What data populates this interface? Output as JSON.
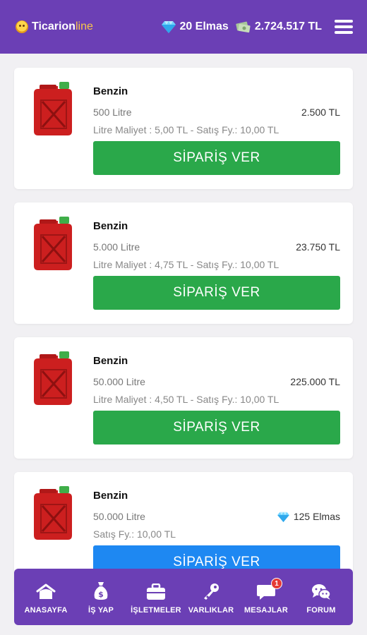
{
  "header": {
    "brand_main": "Ticarion",
    "brand_accent": "line",
    "diamonds": "20 Elmas",
    "balance": "2.724.517 TL",
    "icons": [
      "brand-logo-icon",
      "gem-icon",
      "money-icon",
      "menu-icon"
    ]
  },
  "products": [
    {
      "title": "Benzin",
      "quantity": "500 Litre",
      "price": "2.500 TL",
      "info": "Litre Maliyet : 5,00 TL - Satış Fy.: 10,00 TL",
      "button": "SİPARİŞ VER",
      "button_color": "#2aa84a"
    },
    {
      "title": "Benzin",
      "quantity": "5.000 Litre",
      "price": "23.750 TL",
      "info": "Litre Maliyet : 4,75 TL - Satış Fy.: 10,00 TL",
      "button": "SİPARİŞ VER",
      "button_color": "#2aa84a"
    },
    {
      "title": "Benzin",
      "quantity": "50.000 Litre",
      "price": "225.000 TL",
      "info": "Litre Maliyet : 4,50 TL - Satış Fy.: 10,00 TL",
      "button": "SİPARİŞ VER",
      "button_color": "#2aa84a"
    },
    {
      "title": "Benzin",
      "quantity": "50.000 Litre",
      "price": "125 Elmas",
      "info": "Satış Fy.: 10,00 TL",
      "button": "SİPARİŞ VER",
      "button_color": "#1e88f2"
    }
  ],
  "nav": {
    "items": [
      {
        "label": "ANASAYFA",
        "icon": "home-icon"
      },
      {
        "label": "İŞ YAP",
        "icon": "money-bag-icon"
      },
      {
        "label": "İŞLETMELER",
        "icon": "briefcase-icon"
      },
      {
        "label": "VARLIKLAR",
        "icon": "key-icon"
      },
      {
        "label": "MESAJLAR",
        "icon": "chat-icon",
        "badge": "1"
      },
      {
        "label": "FORUM",
        "icon": "forum-icon"
      }
    ]
  },
  "colors": {
    "primary": "#6b3fb5",
    "accent": "#f7c64a",
    "green": "#2aa84a",
    "blue": "#1e88f2",
    "can_red": "#cc1f1f",
    "can_cap": "#3fae49"
  }
}
